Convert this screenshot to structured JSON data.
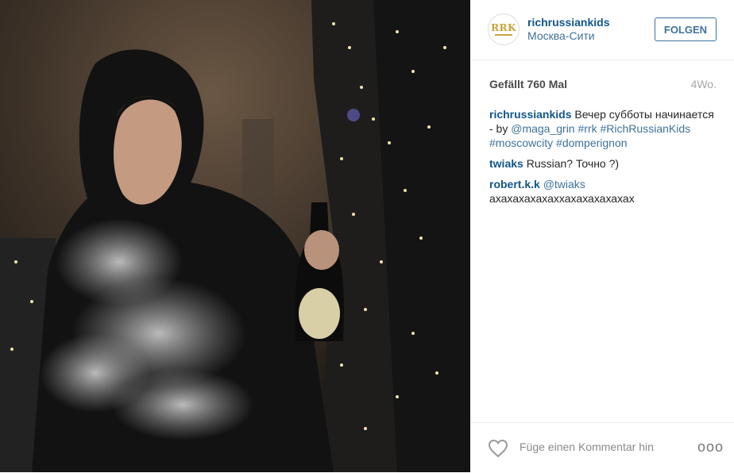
{
  "post": {
    "username": "richrussiankids",
    "location": "Москва-Сити",
    "avatar_text": "RRK",
    "follow_label": "FOLGEN",
    "likes": "Gefällt 760 Mal",
    "time": "4Wo."
  },
  "caption": {
    "user": "richrussiankids",
    "text": "Вечер субботы начинается",
    "glyph": "",
    "by": " - by ",
    "mention": "@maga_grin",
    "hashtags": [
      "#rrk",
      "#RichRussianKids",
      "#moscowcity",
      "#domperignon"
    ]
  },
  "comments": [
    {
      "user": "twiaks",
      "text": "Russian? Точно ?)"
    },
    {
      "user": "robert.k.k",
      "mention": "@twiaks",
      "text": "ахахахахахаххахахахахахах"
    }
  ],
  "footer": {
    "comment_placeholder": "Füge einen Kommentar hinzu...",
    "more": "ooo"
  },
  "icons": {
    "like": "heart-icon",
    "options": "more-options-icon"
  },
  "colors": {
    "username": "#125688",
    "link": "#3f729b",
    "meta": "#a5a7aa",
    "avatar_gold": "#c9a23a"
  }
}
